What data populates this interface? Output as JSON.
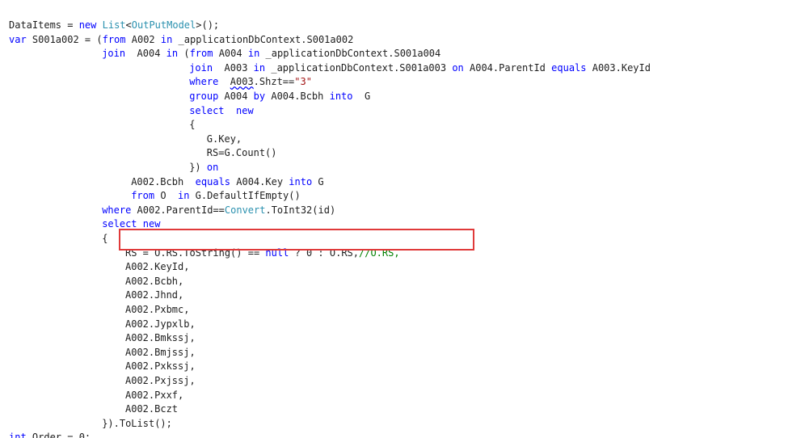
{
  "colors": {
    "background": "#ffffff",
    "plain": "#1e1e1e",
    "keyword": "#0000ff",
    "type": "#2b91af",
    "string": "#a31515",
    "comment": "#008000",
    "highlight_border": "#e03a3a"
  },
  "code": {
    "lines": [
      {
        "indent": 0,
        "tokens": [
          {
            "t": "DataItems = ",
            "k": "plain"
          },
          {
            "t": "new",
            "k": "keyword"
          },
          {
            "t": " ",
            "k": "plain"
          },
          {
            "t": "List",
            "k": "type"
          },
          {
            "t": "<",
            "k": "plain"
          },
          {
            "t": "OutPutModel",
            "k": "type"
          },
          {
            "t": ">();",
            "k": "plain"
          }
        ]
      },
      {
        "indent": 0,
        "tokens": [
          {
            "t": "var",
            "k": "keyword"
          },
          {
            "t": " S001a002 = (",
            "k": "plain"
          },
          {
            "t": "from",
            "k": "keyword"
          },
          {
            "t": " A002 ",
            "k": "plain"
          },
          {
            "t": "in",
            "k": "keyword"
          },
          {
            "t": " _applicationDbContext.S001a002",
            "k": "plain"
          }
        ]
      },
      {
        "indent": 16,
        "tokens": [
          {
            "t": "join",
            "k": "keyword"
          },
          {
            "t": "  A004 ",
            "k": "plain"
          },
          {
            "t": "in",
            "k": "keyword"
          },
          {
            "t": " (",
            "k": "plain"
          },
          {
            "t": "from",
            "k": "keyword"
          },
          {
            "t": " A004 ",
            "k": "plain"
          },
          {
            "t": "in",
            "k": "keyword"
          },
          {
            "t": " _applicationDbContext.S001a004",
            "k": "plain"
          }
        ]
      },
      {
        "indent": 31,
        "tokens": [
          {
            "t": "join",
            "k": "keyword"
          },
          {
            "t": "  A003 ",
            "k": "plain"
          },
          {
            "t": "in",
            "k": "keyword"
          },
          {
            "t": " _applicationDbContext.S001a003 ",
            "k": "plain"
          },
          {
            "t": "on",
            "k": "keyword"
          },
          {
            "t": " A004.ParentId ",
            "k": "plain"
          },
          {
            "t": "equals",
            "k": "keyword"
          },
          {
            "t": " A003.KeyId",
            "k": "plain"
          }
        ]
      },
      {
        "indent": 31,
        "tokens": [
          {
            "t": "where",
            "k": "keyword"
          },
          {
            "t": "  ",
            "k": "plain"
          },
          {
            "t": "A003",
            "k": "uline"
          },
          {
            "t": ".Shzt==",
            "k": "plain"
          },
          {
            "t": "\"3\"",
            "k": "string"
          }
        ]
      },
      {
        "indent": 31,
        "tokens": [
          {
            "t": "group",
            "k": "keyword"
          },
          {
            "t": " A004 ",
            "k": "plain"
          },
          {
            "t": "by",
            "k": "keyword"
          },
          {
            "t": " A004.Bcbh ",
            "k": "plain"
          },
          {
            "t": "into",
            "k": "keyword"
          },
          {
            "t": "  G",
            "k": "plain"
          }
        ]
      },
      {
        "indent": 31,
        "tokens": [
          {
            "t": "select",
            "k": "keyword"
          },
          {
            "t": "  ",
            "k": "plain"
          },
          {
            "t": "new",
            "k": "keyword"
          }
        ]
      },
      {
        "indent": 31,
        "tokens": [
          {
            "t": "{",
            "k": "plain"
          }
        ]
      },
      {
        "indent": 34,
        "tokens": [
          {
            "t": "G.Key,",
            "k": "plain"
          }
        ]
      },
      {
        "indent": 34,
        "tokens": [
          {
            "t": "RS=G.Count()",
            "k": "plain"
          }
        ]
      },
      {
        "indent": 31,
        "tokens": [
          {
            "t": "}) ",
            "k": "plain"
          },
          {
            "t": "on",
            "k": "keyword"
          }
        ]
      },
      {
        "indent": 21,
        "tokens": [
          {
            "t": "A002.Bcbh  ",
            "k": "plain"
          },
          {
            "t": "equals",
            "k": "keyword"
          },
          {
            "t": " A004.Key ",
            "k": "plain"
          },
          {
            "t": "into",
            "k": "keyword"
          },
          {
            "t": " G",
            "k": "plain"
          }
        ]
      },
      {
        "indent": 21,
        "tokens": [
          {
            "t": "from",
            "k": "keyword"
          },
          {
            "t": " O  ",
            "k": "plain"
          },
          {
            "t": "in",
            "k": "keyword"
          },
          {
            "t": " G.DefaultIfEmpty()",
            "k": "plain"
          }
        ]
      },
      {
        "indent": 16,
        "tokens": [
          {
            "t": "where",
            "k": "keyword"
          },
          {
            "t": " A002.ParentId==",
            "k": "plain"
          },
          {
            "t": "Convert",
            "k": "type"
          },
          {
            "t": ".ToInt32(id)",
            "k": "plain"
          }
        ]
      },
      {
        "indent": 16,
        "tokens": [
          {
            "t": "select",
            "k": "keyword"
          },
          {
            "t": " ",
            "k": "plain"
          },
          {
            "t": "new",
            "k": "keyword"
          }
        ]
      },
      {
        "indent": 16,
        "tokens": [
          {
            "t": "{",
            "k": "plain"
          }
        ]
      },
      {
        "indent": 20,
        "tokens": [
          {
            "t": "RS = O.RS.ToString() == ",
            "k": "plain"
          },
          {
            "t": "null",
            "k": "keyword"
          },
          {
            "t": " ? 0 : O.RS,",
            "k": "plain"
          },
          {
            "t": "//O.RS,",
            "k": "comment"
          }
        ]
      },
      {
        "indent": 20,
        "tokens": [
          {
            "t": "A002.KeyId,",
            "k": "plain"
          }
        ]
      },
      {
        "indent": 20,
        "tokens": [
          {
            "t": "A002.Bcbh,",
            "k": "plain"
          }
        ]
      },
      {
        "indent": 20,
        "tokens": [
          {
            "t": "A002.Jhnd,",
            "k": "plain"
          }
        ]
      },
      {
        "indent": 20,
        "tokens": [
          {
            "t": "A002.Pxbmc,",
            "k": "plain"
          }
        ]
      },
      {
        "indent": 20,
        "tokens": [
          {
            "t": "A002.Jypxlb,",
            "k": "plain"
          }
        ]
      },
      {
        "indent": 20,
        "tokens": [
          {
            "t": "A002.Bmkssj,",
            "k": "plain"
          }
        ]
      },
      {
        "indent": 20,
        "tokens": [
          {
            "t": "A002.Bmjssj,",
            "k": "plain"
          }
        ]
      },
      {
        "indent": 20,
        "tokens": [
          {
            "t": "A002.Pxkssj,",
            "k": "plain"
          }
        ]
      },
      {
        "indent": 20,
        "tokens": [
          {
            "t": "A002.Pxjssj,",
            "k": "plain"
          }
        ]
      },
      {
        "indent": 20,
        "tokens": [
          {
            "t": "A002.Pxxf,",
            "k": "plain"
          }
        ]
      },
      {
        "indent": 20,
        "tokens": [
          {
            "t": "A002.Bczt",
            "k": "plain"
          }
        ]
      },
      {
        "indent": 16,
        "tokens": [
          {
            "t": "}).ToList();",
            "k": "plain"
          }
        ]
      },
      {
        "indent": 0,
        "tokens": [
          {
            "t": "int",
            "k": "keyword"
          },
          {
            "t": " Order = 0;",
            "k": "plain"
          }
        ]
      }
    ]
  }
}
